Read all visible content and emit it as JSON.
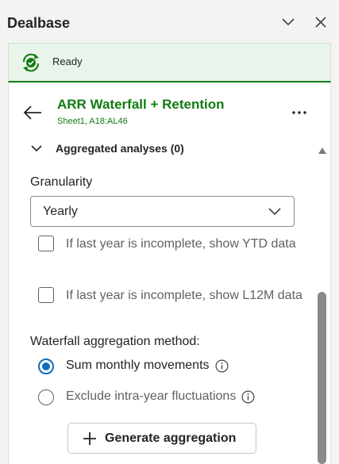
{
  "app": {
    "title": "Dealbase"
  },
  "status": {
    "text": "Ready",
    "color": "#107c10"
  },
  "report": {
    "title": "ARR Waterfall + Retention",
    "subtitle": "Sheet1, A18:AL46"
  },
  "section": {
    "label": "Aggregated analyses (0)"
  },
  "granularity": {
    "label": "Granularity",
    "selected": "Yearly"
  },
  "options": {
    "ytd_label": "If last year is incomplete, show YTD data",
    "l12m_label": "If last year is incomplete, show L12M data"
  },
  "method": {
    "label": "Waterfall aggregation method:",
    "sum_label": "Sum monthly movements",
    "exclude_label": "Exclude intra-year fluctuations"
  },
  "actions": {
    "generate_label": "Generate aggregation"
  },
  "icons": {
    "status": "refresh-check-icon",
    "back": "arrow-left-icon",
    "more": "more-horizontal-icon",
    "collapse": "chevron-down-icon",
    "close": "close-icon",
    "info": "info-icon",
    "add": "plus-icon"
  },
  "colors": {
    "accent": "#107c10",
    "radio_selected": "#0f6cbd"
  }
}
